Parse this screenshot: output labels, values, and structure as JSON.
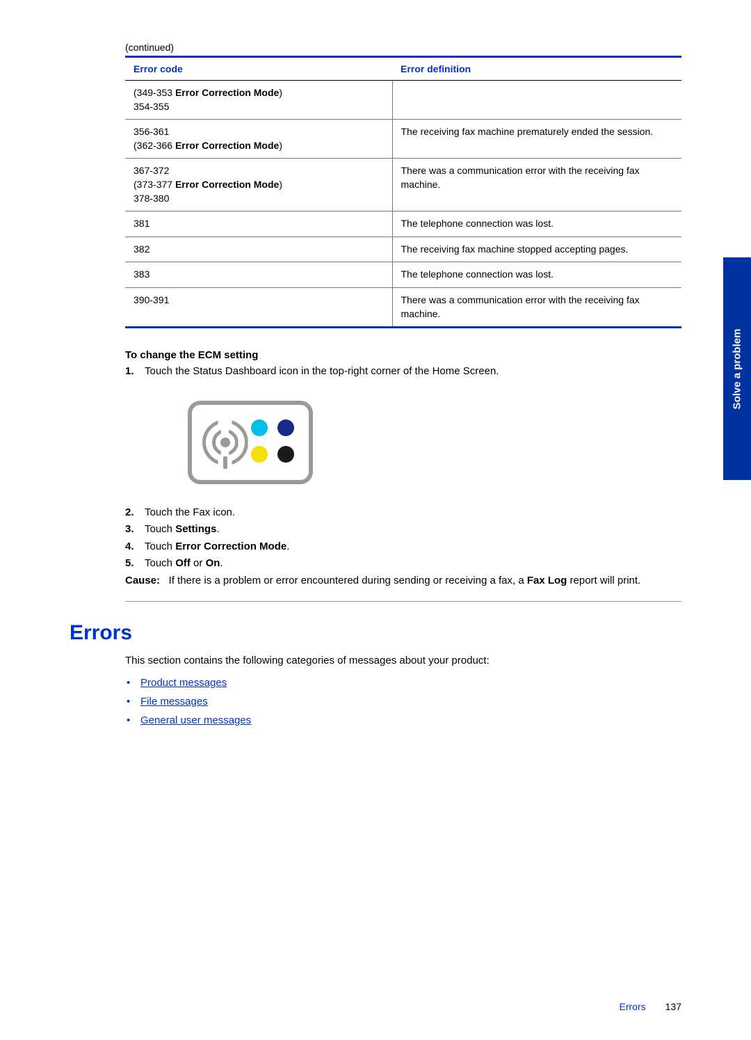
{
  "sideTab": "Solve a problem",
  "continued": "(continued)",
  "tableHeaders": {
    "c1": "Error code",
    "c2": "Error definition"
  },
  "ecmLabel": "Error Correction Mode",
  "rows": [
    {
      "c1a": "349-353",
      "c1aEcm": true,
      "c1b": "354-355",
      "c2": ""
    },
    {
      "c1a": "356-361",
      "c1b": "362-366",
      "c1bEcm": true,
      "c2": "The receiving fax machine prematurely ended the session."
    },
    {
      "c1a": "367-372",
      "c1b": "373-377",
      "c1bEcm": true,
      "c1c": "378-380",
      "c2": "There was a communication error with the receiving fax machine."
    },
    {
      "c1a": "381",
      "c2": "The telephone connection was lost."
    },
    {
      "c1a": "382",
      "c2": "The receiving fax machine stopped accepting pages."
    },
    {
      "c1a": "383",
      "c2": "The telephone connection was lost."
    },
    {
      "c1a": "390-391",
      "c2": "There was a communication error with the receiving fax machine."
    }
  ],
  "ecmHeading": "To change the ECM setting",
  "steps": {
    "s1": "Touch the Status Dashboard icon in the top-right corner of the Home Screen.",
    "s2": "Touch the Fax icon.",
    "s3a": "Touch ",
    "s3b": "Settings",
    "s4a": "Touch ",
    "s4b": "Error Correction Mode",
    "s5a": "Touch ",
    "s5b": "Off",
    "s5c": " or ",
    "s5d": "On"
  },
  "cause": {
    "label": "Cause:",
    "textA": "If there is a problem or error encountered during sending or receiving a fax, a ",
    "bold": "Fax Log",
    "textB": " report will print."
  },
  "errorsHeading": "Errors",
  "errorsIntro": "This section contains the following categories of messages about your product:",
  "links": [
    "Product messages",
    "File messages",
    "General user messages"
  ],
  "footer": {
    "section": "Errors",
    "page": "137"
  }
}
